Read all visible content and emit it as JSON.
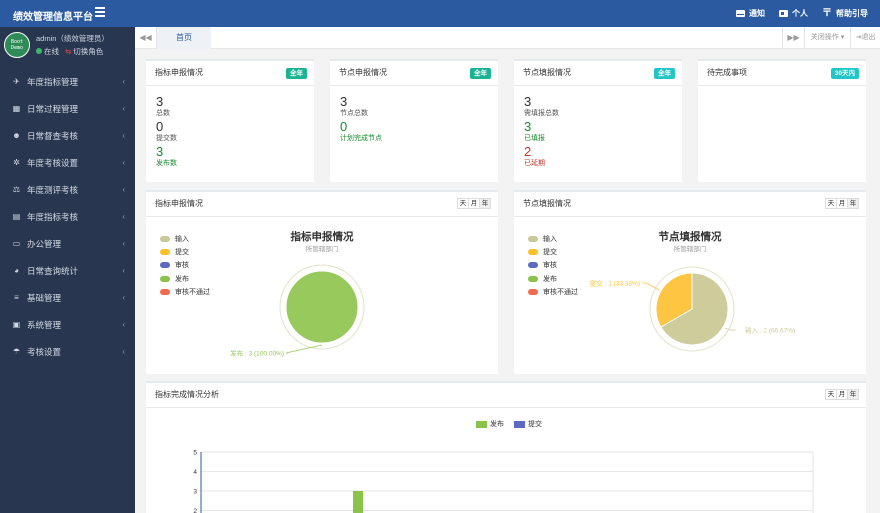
{
  "header": {
    "brand": "绩效管理信息平台",
    "right_items": [
      {
        "label": "通知",
        "icon": "envelope-icon"
      },
      {
        "label": "个人",
        "icon": "id-card-icon"
      },
      {
        "label": "帮助引导",
        "icon": "help-icon"
      }
    ]
  },
  "user": {
    "avatar_text_1": "Boot",
    "avatar_text_2": "Demo",
    "name": "admin（绩效管理员）",
    "status": "在线",
    "switch_role": "切换角色"
  },
  "sidebar": {
    "items": [
      {
        "label": "年度指标管理",
        "icon": "send-icon"
      },
      {
        "label": "日常过程管理",
        "icon": "calendar-icon"
      },
      {
        "label": "日常督查考核",
        "icon": "users-icon"
      },
      {
        "label": "年度考核设置",
        "icon": "gear-icon"
      },
      {
        "label": "年度测评考核",
        "icon": "scale-icon"
      },
      {
        "label": "年度指标考核",
        "icon": "calculator-icon"
      },
      {
        "label": "办公管理",
        "icon": "laptop-icon"
      },
      {
        "label": "日常查询统计",
        "icon": "pie-chart-icon"
      },
      {
        "label": "基础管理",
        "icon": "list-icon"
      },
      {
        "label": "系统管理",
        "icon": "desktop-icon"
      },
      {
        "label": "考核设置",
        "icon": "umbrella-icon"
      }
    ]
  },
  "tabs": {
    "home": "首页",
    "close_ops": "关闭操作",
    "exit": "退出"
  },
  "cards": [
    {
      "title": "指标申报情况",
      "badge": "全年",
      "badge_color": "#1ab394",
      "rows": [
        {
          "value": "3",
          "label": "总数",
          "tone": ""
        },
        {
          "value": "0",
          "label": "提交数",
          "tone": ""
        },
        {
          "value": "3",
          "label": "发布数",
          "tone": "g"
        }
      ]
    },
    {
      "title": "节点申报情况",
      "badge": "全年",
      "badge_color": "#1ab394",
      "rows": [
        {
          "value": "3",
          "label": "节点总数",
          "tone": ""
        },
        {
          "value": "0",
          "label": "计划完成节点",
          "tone": "g"
        }
      ]
    },
    {
      "title": "节点填报情况",
      "badge": "全年",
      "badge_color": "#23c6c8",
      "rows": [
        {
          "value": "3",
          "label": "需填报总数",
          "tone": ""
        },
        {
          "value": "3",
          "label": "已填报",
          "tone": "g"
        },
        {
          "value": "2",
          "label": "已延期",
          "tone": "r"
        }
      ]
    },
    {
      "title": "待完成事项",
      "badge": "30天内",
      "badge_color": "#23c6c8",
      "rows": []
    }
  ],
  "range_buttons": [
    "天",
    "月",
    "年"
  ],
  "pie_panels": [
    {
      "header": "指标申报情况",
      "title": "指标申报情况",
      "subtitle": "所管辖部门",
      "legend": [
        {
          "name": "输入",
          "color": "#c7c998"
        },
        {
          "name": "提交",
          "color": "#fbc02d"
        },
        {
          "name": "审核",
          "color": "#5c6bc0"
        },
        {
          "name": "发布",
          "color": "#8bc34a"
        },
        {
          "name": "审核不通过",
          "color": "#ef6c4b"
        }
      ]
    },
    {
      "header": "节点填报情况",
      "title": "节点填报情况",
      "subtitle": "所管辖部门",
      "legend": [
        {
          "name": "输入",
          "color": "#c7c998"
        },
        {
          "name": "提交",
          "color": "#fbc02d"
        },
        {
          "name": "审核",
          "color": "#5c6bc0"
        },
        {
          "name": "发布",
          "color": "#8bc34a"
        },
        {
          "name": "审核不通过",
          "color": "#ef6c4b"
        }
      ]
    }
  ],
  "bottom_panel": {
    "header": "指标完成情况分析",
    "legend": [
      {
        "name": "发布",
        "color": "#8bc34a"
      },
      {
        "name": "提交",
        "color": "#5c6bc0"
      }
    ]
  },
  "chart_data": [
    {
      "type": "pie",
      "title": "指标申报情况",
      "subtitle": "所管辖部门",
      "slices": [
        {
          "name": "发布",
          "value": 3,
          "label": "发布 : 3 (100.00%)",
          "color": "#97c95c"
        }
      ]
    },
    {
      "type": "pie",
      "title": "节点填报情况",
      "subtitle": "所管辖部门",
      "slices": [
        {
          "name": "输入",
          "value": 2,
          "label": "输入 : 2 (66.67%)",
          "color": "#cfcc9c"
        },
        {
          "name": "提交",
          "value": 1,
          "label": "提交 : 1 (33.33%)",
          "color": "#fdc541"
        }
      ]
    },
    {
      "type": "bar",
      "title": "",
      "series": [
        {
          "name": "发布",
          "values": [
            3
          ]
        },
        {
          "name": "提交",
          "values": [
            0
          ]
        }
      ],
      "yticks": [
        2,
        3,
        4,
        5
      ],
      "ylim": [
        0,
        5
      ]
    }
  ]
}
